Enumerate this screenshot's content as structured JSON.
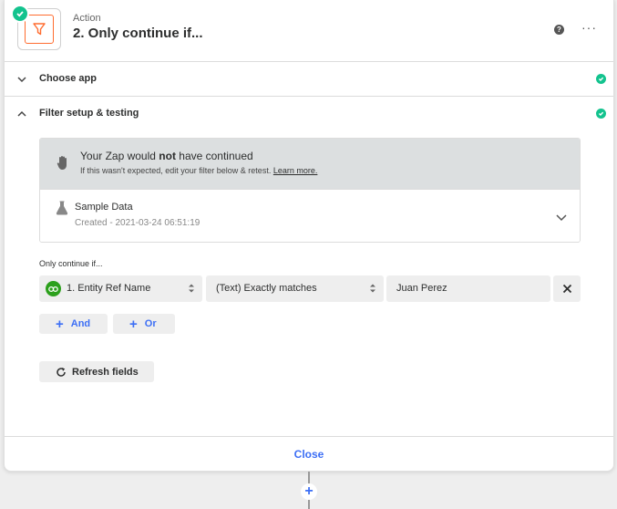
{
  "header": {
    "kind": "Action",
    "title": "2. Only continue if...",
    "help_glyph": "?",
    "more_glyph": "···"
  },
  "sections": {
    "choose_app": "Choose app",
    "filter_setup": "Filter setup & testing"
  },
  "alert": {
    "head_prefix": "Your Zap would ",
    "head_bold": "not",
    "head_suffix": " have continued",
    "sub": "If this wasn't expected, edit your filter below & retest. ",
    "link": "Learn more."
  },
  "sample": {
    "label": "Sample Data",
    "created": "Created - 2021-03-24 06:51:19"
  },
  "filter": {
    "label": "Only continue if...",
    "field": "1. Entity Ref Name",
    "condition": "(Text) Exactly matches",
    "value": "Juan Perez",
    "and_label": "And",
    "or_label": "Or",
    "refresh_label": "Refresh fields"
  },
  "footer": {
    "close_label": "Close"
  },
  "add_step_glyph": "+",
  "colors": {
    "accent": "#3d6ff5",
    "success": "#13c38e",
    "filter_orange": "#ff6c2f",
    "quickbooks_green": "#2ca01c"
  }
}
